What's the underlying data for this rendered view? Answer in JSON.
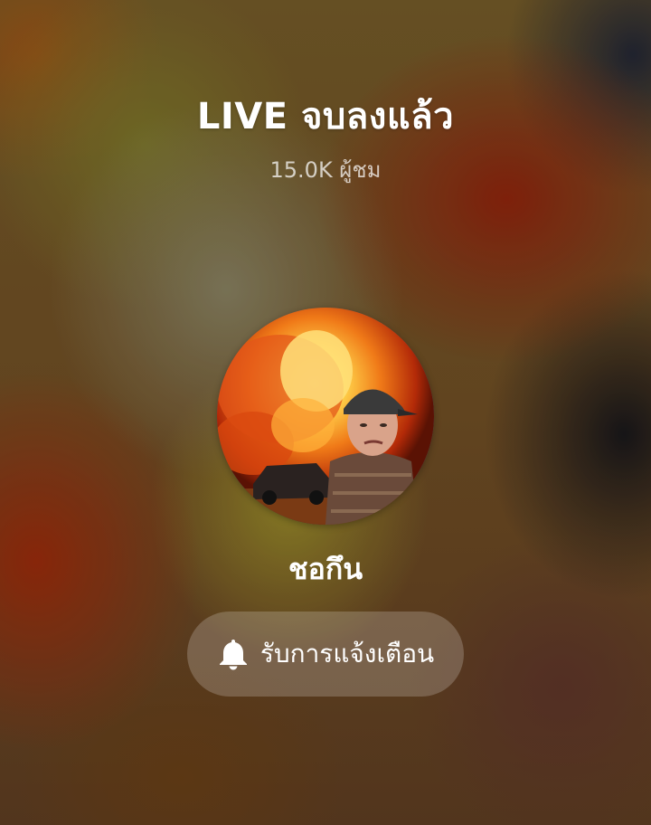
{
  "live_ended": {
    "title": "LIVE จบลงแล้ว",
    "viewers": "15.0K ผู้ชม"
  },
  "host": {
    "name": "ชอกึน",
    "avatar_icon": "profile-photo"
  },
  "notify_button": {
    "label": "รับการแจ้งเตือน",
    "icon": "bell-icon"
  }
}
